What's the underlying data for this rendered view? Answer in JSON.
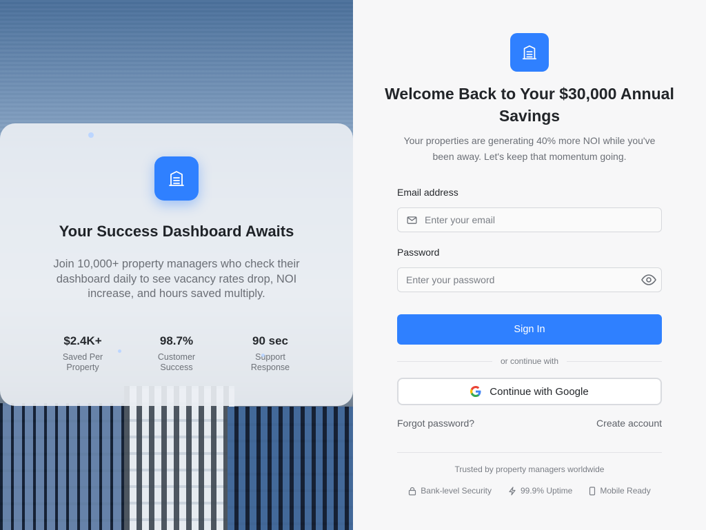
{
  "hero": {
    "title": "Your Success Dashboard Awaits",
    "description": "Join 10,000+ property managers who check their dashboard daily to see vacancy rates drop, NOI increase, and hours saved multiply.",
    "stats": [
      {
        "value": "$2.4K+",
        "label": "Saved Per Property"
      },
      {
        "value": "98.7%",
        "label": "Customer Success"
      },
      {
        "value": "90 sec",
        "label": "Support Response"
      }
    ]
  },
  "login": {
    "title": "Welcome Back to Your $30,000 Annual Savings",
    "subtitle": "Your properties are generating 40% more NOI while you've been away. Let's keep that momentum going.",
    "email_label": "Email address",
    "email_placeholder": "Enter your email",
    "password_label": "Password",
    "password_placeholder": "Enter your password",
    "sign_in_label": "Sign In",
    "divider_text": "or continue with",
    "google_label": "Continue with Google",
    "forgot_label": "Forgot password?",
    "create_label": "Create account",
    "trusted_text": "Trusted by property managers worldwide",
    "badges": [
      {
        "icon": "lock-icon",
        "label": "Bank-level Security"
      },
      {
        "icon": "bolt-icon",
        "label": "99.9% Uptime"
      },
      {
        "icon": "phone-icon",
        "label": "Mobile Ready"
      }
    ]
  },
  "colors": {
    "accent": "#2f80ff",
    "background": "#f7f7f8"
  }
}
